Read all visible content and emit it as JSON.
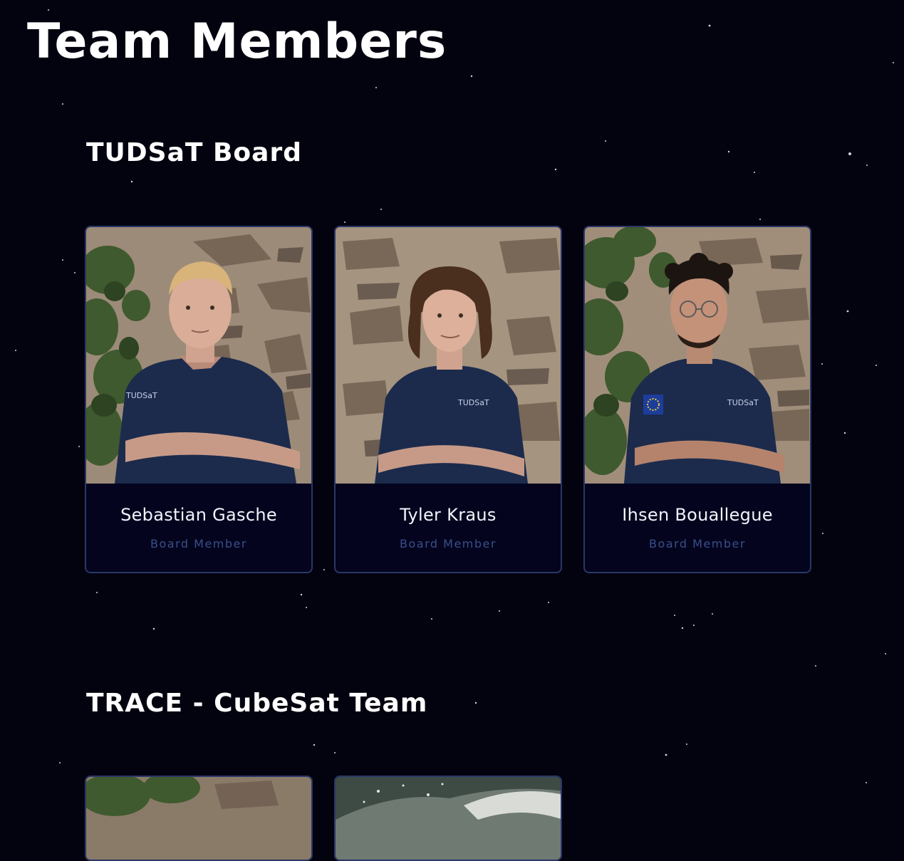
{
  "page": {
    "title": "Team Members"
  },
  "sections": [
    {
      "title": "TUDSaT Board",
      "members": [
        {
          "name": "Sebastian Gasche",
          "role": "Board Member",
          "photo": "portrait-blond-short-hair"
        },
        {
          "name": "Tyler Kraus",
          "role": "Board Member",
          "photo": "portrait-long-brown-hair"
        },
        {
          "name": "Ihsen Bouallegue",
          "role": "Board Member",
          "photo": "portrait-curly-hair-glasses"
        }
      ]
    },
    {
      "title": "TRACE - CubeSat Team",
      "members": [
        {
          "name": "",
          "role": "",
          "photo": "portrait-ivy-wall"
        },
        {
          "name": "",
          "role": "",
          "photo": "space-debris-image"
        }
      ]
    }
  ],
  "colors": {
    "background": "#03030f",
    "card_background": "#04041e",
    "card_border": "#2a3769",
    "role_text": "#3a4f8a",
    "name_text": "#f2f3fb"
  }
}
